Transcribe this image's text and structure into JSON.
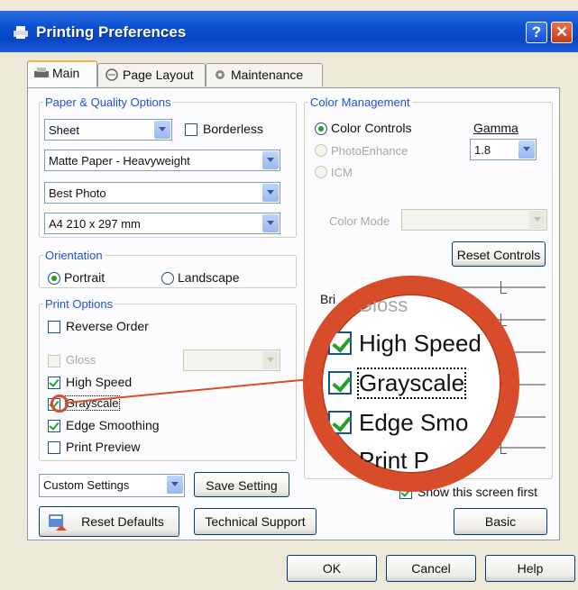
{
  "window": {
    "title": "Printing Preferences",
    "help_label": "?",
    "close_label": "✕",
    "app_icon": "printer-icon"
  },
  "tabs": [
    {
      "label": "Main",
      "icon": "printer-icon",
      "active": true
    },
    {
      "label": "Page Layout",
      "icon": "page-layout-icon",
      "active": false
    },
    {
      "label": "Maintenance",
      "icon": "maintenance-icon",
      "active": false
    }
  ],
  "paper_quality": {
    "legend": "Paper & Quality Options",
    "sheet_value": "Sheet",
    "borderless_label": "Borderless",
    "media_value": "Matte Paper - Heavyweight",
    "quality_value": "Best Photo",
    "size_value": "A4 210 x 297 mm"
  },
  "orientation": {
    "legend": "Orientation",
    "portrait_label": "Portrait",
    "landscape_label": "Landscape"
  },
  "print_options": {
    "legend": "Print Options",
    "reverse_order": "Reverse Order",
    "gloss": "Gloss",
    "high_speed": "High Speed",
    "grayscale": "Grayscale",
    "edge_smoothing": "Edge Smoothing",
    "print_preview": "Print Preview"
  },
  "custom_settings": {
    "value": "Custom Settings",
    "save_label": "Save Setting"
  },
  "reset_defaults_label": "Reset Defaults",
  "technical_support_label": "Technical Support",
  "color_management": {
    "legend": "Color Management",
    "color_controls": "Color Controls",
    "photo_enhance": "PhotoEnhance",
    "icm": "ICM",
    "gamma_label": "Gamma",
    "gamma_value": "1.8",
    "color_mode_label": "Color Mode",
    "reset_controls_label": "Reset Controls",
    "brightness_partial": "Bri"
  },
  "magnifier": {
    "gloss": "Gloss",
    "high_speed": "High Speed",
    "grayscale": "Grayscale",
    "edge_smoothing": "Edge Smo",
    "print_preview": "Print P"
  },
  "show_screen_first_label": "Show this screen first",
  "basic_label": "Basic",
  "footer": {
    "ok": "OK",
    "cancel": "Cancel",
    "help": "Help"
  }
}
